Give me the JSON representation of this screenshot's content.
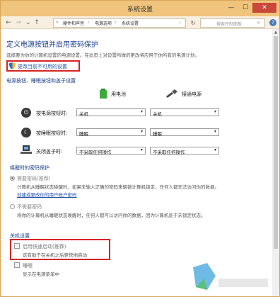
{
  "window": {
    "title": "系统设置"
  },
  "address_bar": {
    "crumbs": [
      "硬件和声音",
      "电源选项",
      "系统设置"
    ],
    "search_placeholder": "搜索控制面板"
  },
  "page": {
    "heading": "定义电源按钮并启用密码保护",
    "description": "选择要为你的计算机设置的电源设置。在此页上对设置所做的更改将应用于你所有的电源计划。",
    "change_link": "更改当前不可用的设置"
  },
  "buttons_section": {
    "title": "电源按钮、睡眠按钮和盖子设置",
    "col_battery": "用电池",
    "col_plugged": "接通电源",
    "rows": [
      {
        "label": "按电源按钮时:",
        "battery": "关机",
        "plugged": "关机"
      },
      {
        "label": "按睡眠按钮时:",
        "battery": "睡眠",
        "plugged": "睡眠"
      },
      {
        "label": "关闭盖子时:",
        "battery": "不采取任何操作",
        "plugged": "不采取任何操作"
      }
    ]
  },
  "wake_section": {
    "title": "唤醒时的密码保护",
    "opt1_label": "需要密码(推荐)",
    "opt1_desc": "计算机从睡眠状态唤醒时，如果未输入正确的密码来解锁计算机锁定，任何人都无法访问你的数据。",
    "opt1_link": "创建或更改你的用户帐户密码",
    "opt2_label": "不需要密码",
    "opt2_desc": "将你的计算机从睡眠状态唤醒时，任何人都可以访问你的数据，因为计算机处于未锁定状态。"
  },
  "shutdown_section": {
    "title": "关机设置",
    "fast_startup_label": "启用快速启动(推荐)",
    "fast_startup_desc": "这有助于在关机之后更快地启动",
    "sleep_label": "睡眠",
    "sleep_desc": "显示在电源菜单中"
  },
  "colors": {
    "titlebar": "#f0c47c",
    "heading": "#1a3e8c",
    "link": "#1e4fa8",
    "highlight": "#d72424"
  }
}
